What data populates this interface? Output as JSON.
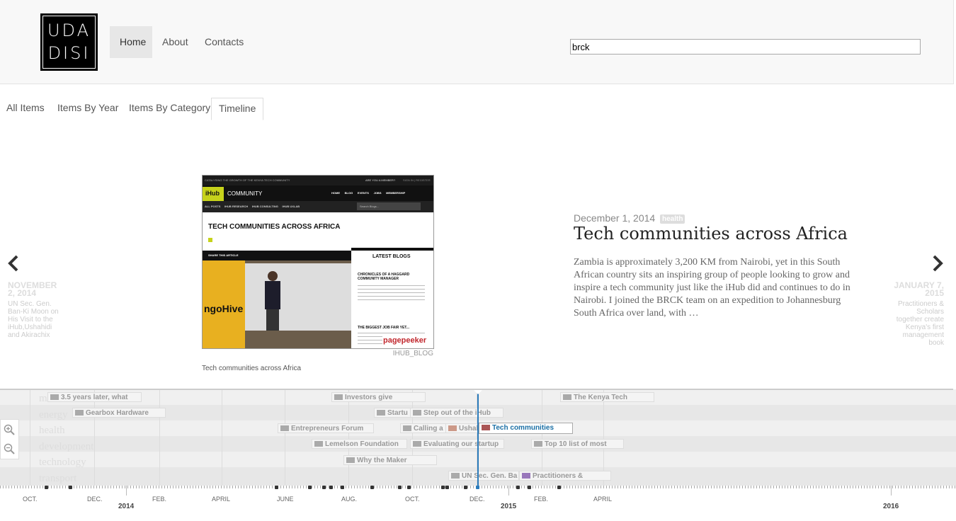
{
  "header": {
    "logo_line1": "UDA",
    "logo_line2": "DISI",
    "nav": [
      "Home",
      "About",
      "Contacts"
    ],
    "search_value": "brck"
  },
  "tabs": [
    "All Items",
    "Items By Year",
    "Items By Category",
    "Timeline"
  ],
  "slide": {
    "date": "December 1, 2014",
    "category": "health",
    "title": "Tech communities across Africa",
    "description": "Zambia is approximately 3,200 KM from Nairobi, yet in this South African country sits an inspiring group of people looking to grow and inspire a tech community just like the iHub did and continues to do in Nairobi. I joined the BRCK team on an expedition to Johannesburg South Africa over land, with …",
    "media_credit": "IHUB_BLOG",
    "media_caption": "Tech communities across Africa",
    "screenshot": {
      "topbar": "CATALYSING THE GROWTH OF THE KENYA TECH COMMUNITY",
      "member": "ARE YOU A MEMBER?",
      "signin": "SIGN IN | REGISTER",
      "brand": "iHub",
      "brand_suffix": "COMMUNITY",
      "menu": [
        "HOME",
        "BLOG",
        "EVENTS",
        "JOBS",
        "MEMBERSHIP"
      ],
      "submenu": [
        "ALL POSTS",
        "IHUB RESEARCH",
        "IHUB CONSULTING",
        "IHUB UXLAB"
      ],
      "search": "Search Blogs...",
      "headline": "TECH COMMUNITIES ACROSS AFRICA",
      "share": "SHARE THIS ARTICLE",
      "latest": "LATEST BLOGS",
      "post1": "CHRONICLES OF A HAGGARD COMMUNITY MANAGER",
      "post2": "THE BIGGEST JOB FAIR YET...",
      "stage_text": "ngoHive",
      "watermark": "pagepeeker"
    }
  },
  "prev": {
    "date_line1": "NOVEMBER",
    "date_line2": "2, 2014",
    "text": "UN Sec. Gen. Ban-Ki Moon on His Visit to the iHub,Ushahidi and Akirachix"
  },
  "next": {
    "date_line1": "JANUARY 7,",
    "date_line2": "2015",
    "text": "Practitioners & Scholars together create Kenya's first management book"
  },
  "timeline": {
    "categories": [
      "m",
      "energy",
      "health",
      "development",
      "technology",
      "transport"
    ],
    "flags": [
      "3.5 years later, what",
      "Gearbox Hardware",
      "Entrepreneurs Forum",
      "Lemelson Foundation",
      "Why the Maker",
      "Investors give",
      "Startu",
      "Step out of the iHub",
      "Calling a",
      "Ushal",
      "Tech communities",
      "Evaluating our startup",
      "UN Sec. Gen. Ba",
      "Practitioners &",
      "The Kenya Tech",
      "Top 10 list of most"
    ],
    "months": [
      "OCT.",
      "DEC.",
      "FEB.",
      "APRIL",
      "JUNE",
      "AUG.",
      "OCT.",
      "DEC.",
      "FEB.",
      "APRIL"
    ],
    "years": [
      "2014",
      "2015",
      "2016"
    ]
  },
  "colors": {
    "accent": "#2b7bbb",
    "badge": "#dddddd",
    "header_bg": "#f8f8f8"
  },
  "icons": [
    "chevron-left-icon",
    "chevron-right-icon",
    "zoom-in-icon",
    "zoom-out-icon"
  ]
}
